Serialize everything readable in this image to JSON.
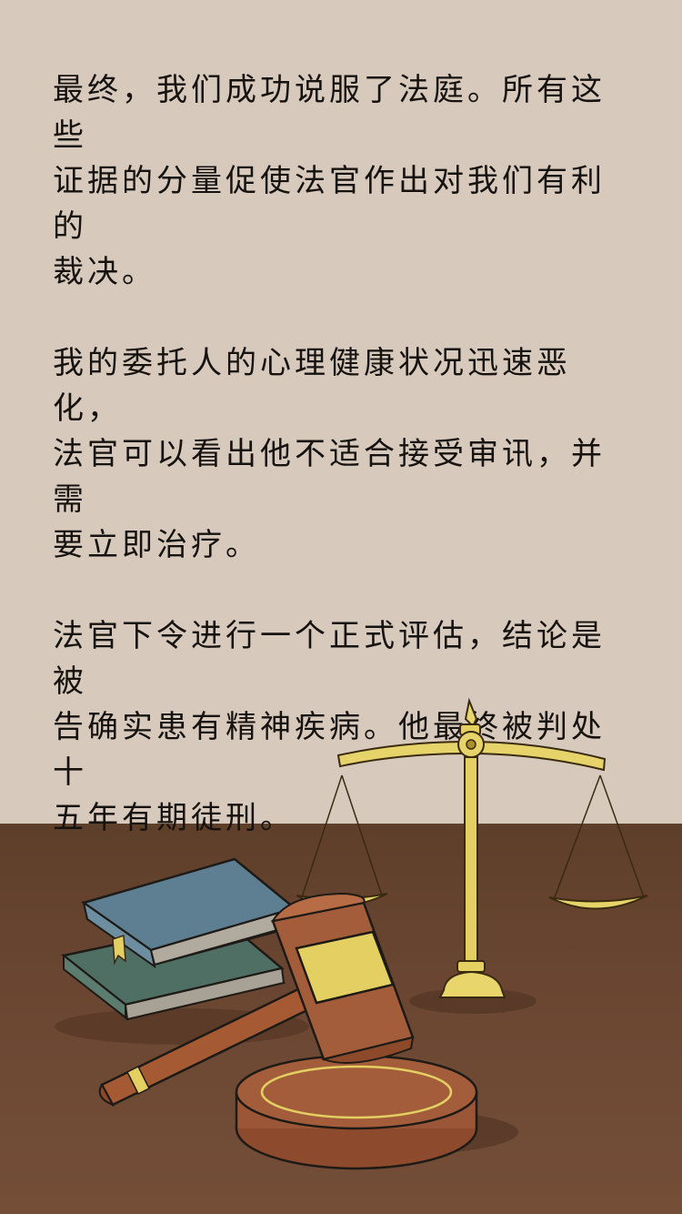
{
  "story": {
    "paragraphs": [
      "最终，我们成功说服了法庭。所有这些\n证据的分量促使法官作出对我们有利的\n裁决。",
      "我的委托人的心理健康状况迅速恶化，\n法官可以看出他不适合接受审讯，并需\n要立即治疗。",
      "法官下令进行一个正式评估，结论是被\n告确实患有精神疾病。他最终被判处十\n五年有期徒刑。"
    ]
  },
  "illustration": {
    "objects": [
      "scales-of-justice",
      "law-books",
      "judge-gavel",
      "sound-block"
    ],
    "colors": {
      "wall": "#d7cabc",
      "table": "#6a4632",
      "brass": "#e6d36a",
      "book_blue": "#5e7f92",
      "book_green": "#4f6f64",
      "gavel": "#9a5a3a"
    }
  }
}
